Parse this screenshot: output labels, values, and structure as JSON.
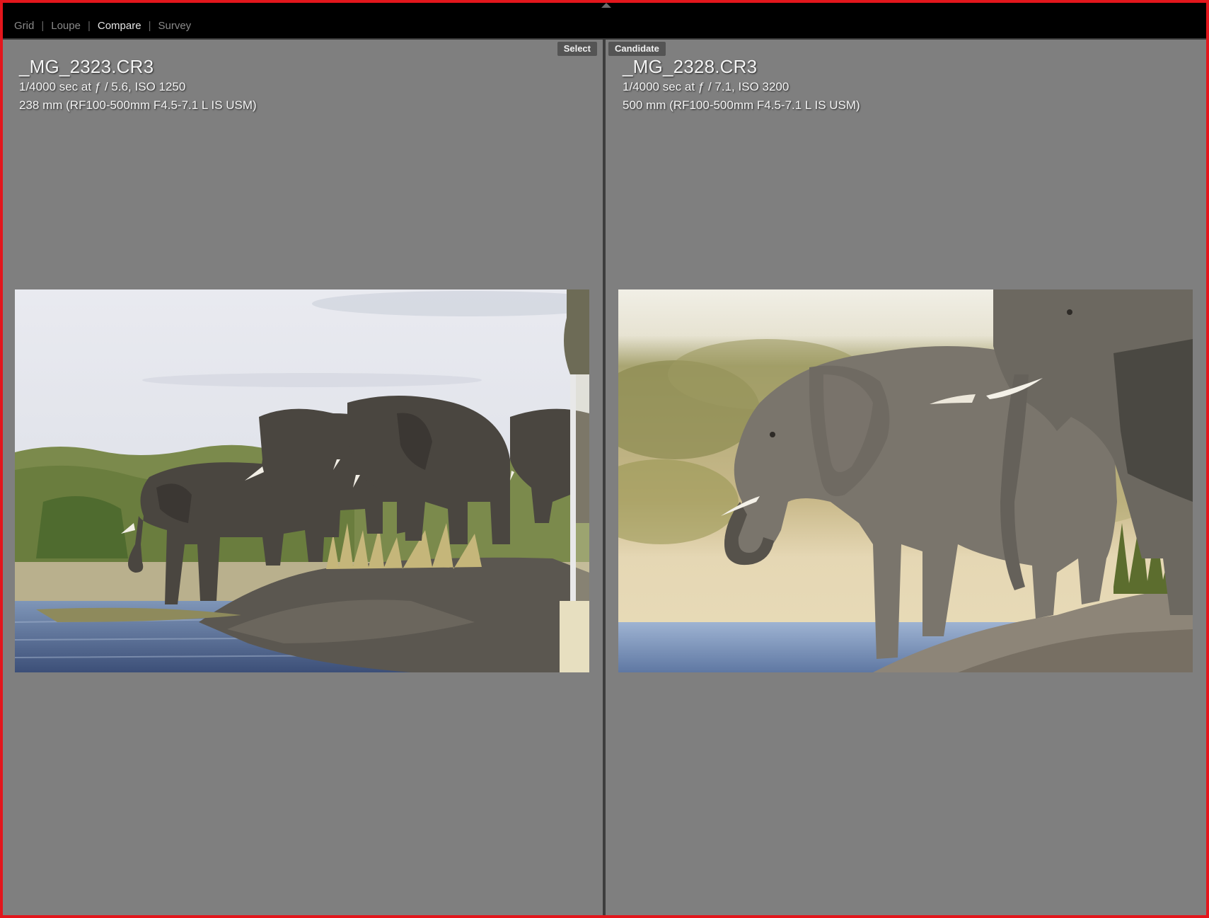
{
  "toolbar": {
    "tabs": [
      {
        "label": "Grid",
        "active": false
      },
      {
        "label": "Loupe",
        "active": false
      },
      {
        "label": "Compare",
        "active": true
      },
      {
        "label": "Survey",
        "active": false
      }
    ]
  },
  "compare": {
    "select": {
      "badge": "Select",
      "filename": "_MG_2323.CR3",
      "exposure": "1/4000 sec at ƒ / 5.6, ISO 1250",
      "lens": "238 mm (RF100-500mm F4.5-7.1 L IS USM)"
    },
    "candidate": {
      "badge": "Candidate",
      "filename": "_MG_2328.CR3",
      "exposure": "1/4000 sec at ƒ / 7.1, ISO 3200",
      "lens": "500 mm (RF100-500mm F4.5-7.1 L IS USM)"
    }
  },
  "colors": {
    "frame_border": "#e3161c",
    "pane_background": "#7f7f7f",
    "toolbar_background": "#000000"
  }
}
